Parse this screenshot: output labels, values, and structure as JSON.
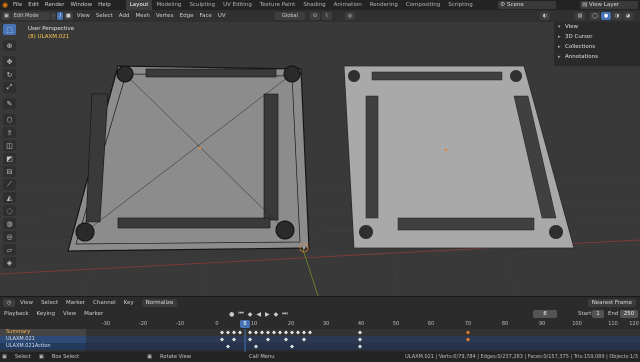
{
  "menubar": {
    "items": [
      "File",
      "Edit",
      "Render",
      "Window",
      "Help"
    ],
    "workspaces": [
      "Layout",
      "Modeling",
      "Sculpting",
      "UV Editing",
      "Texture Paint",
      "Shading",
      "Animation",
      "Rendering",
      "Compositing",
      "Scripting"
    ],
    "active_workspace": "Layout",
    "scene": "Scene",
    "view_layer": "View Layer"
  },
  "header": {
    "mode": "Edit Mode",
    "menus": [
      "View",
      "Select",
      "Add",
      "Mesh",
      "Vertex",
      "Edge",
      "Face",
      "UV"
    ],
    "transform_orientation": "Global"
  },
  "viewport": {
    "perspective_label": "User Perspective",
    "object_label": "(8) ULAXM.021"
  },
  "n_panel": {
    "items": [
      "View",
      "3D Cursor",
      "Collections",
      "Annotations"
    ]
  },
  "timeline_header": {
    "menus": [
      "View",
      "Select",
      "Marker",
      "Channel",
      "Key"
    ],
    "normalize_label": "Normalize",
    "interpolation": "Nearest Frame"
  },
  "timeline_ctrl": {
    "playback_label": "Playback",
    "keying_label": "Keying",
    "view_label": "View",
    "marker_label": "Marker",
    "current_frame": "8",
    "start_label": "Start",
    "start_value": "1",
    "end_label": "End",
    "end_value": "250"
  },
  "dopesheet": {
    "channels": [
      "Summary",
      "ULAXM.021",
      "ULAXM.021Action"
    ],
    "ruler_ticks": [
      "-30",
      "-20",
      "-10",
      "0",
      "10",
      "20",
      "30",
      "40",
      "50",
      "60",
      "70",
      "80",
      "90",
      "100",
      "110",
      "120"
    ],
    "current_frame": "8"
  },
  "statusbar": {
    "select": "Select",
    "box_select": "Box Select",
    "rotate_view": "Rotate View",
    "call_menu": "Call Menu",
    "stats": "ULAXM.021 | Verts:0/79,784 | Edges:0/237,283 | Faces:0/157,375 | Tris:159,089 | Objects:1/3"
  },
  "colors": {
    "accent": "#4772b3",
    "orange": "#e87d0d",
    "summary_text": "#ffb14a"
  }
}
